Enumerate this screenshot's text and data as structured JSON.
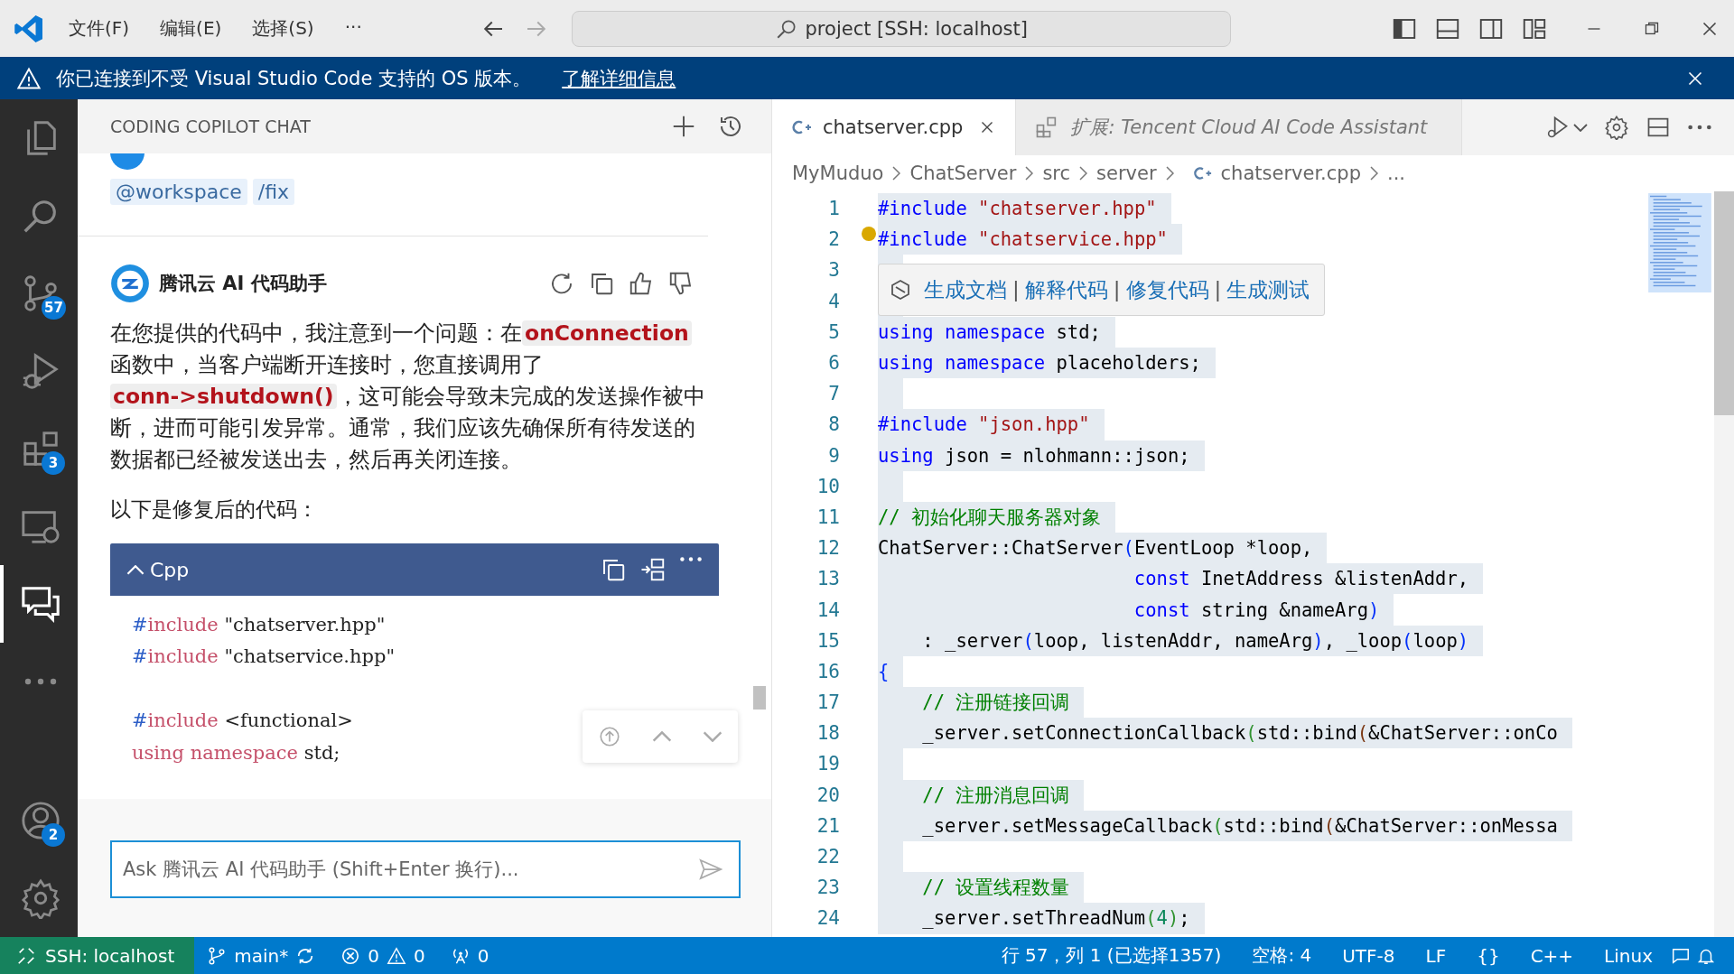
{
  "title_bar": {
    "menus": [
      "文件(F)",
      "编辑(E)",
      "选择(S)"
    ],
    "more": "···",
    "search": "project [SSH: localhost]"
  },
  "notification": {
    "message": "你已连接到不受 Visual Studio Code 支持的 OS 版本。",
    "link": "了解详细信息"
  },
  "activity_bar": {
    "items": [
      {
        "kind": "files",
        "selected": false
      },
      {
        "kind": "search",
        "selected": false
      },
      {
        "kind": "source-control",
        "selected": false,
        "badge": "57"
      },
      {
        "kind": "run-debug",
        "selected": false
      },
      {
        "kind": "extensions",
        "selected": false,
        "badge": "3"
      },
      {
        "kind": "remote",
        "selected": false
      },
      {
        "kind": "chat",
        "selected": true
      },
      {
        "kind": "more",
        "selected": false
      }
    ],
    "bottom": [
      {
        "kind": "account",
        "selected": false,
        "badge": "2"
      },
      {
        "kind": "settings",
        "selected": false
      }
    ]
  },
  "chat": {
    "title": "CODING COPILOT CHAT",
    "chips": [
      "@workspace",
      "/fix"
    ],
    "assistant": "腾讯云 AI 代码助手",
    "message": "在您提供的代码中，我注意到一个问题：在**onConnection**函数中，当客户端断开连接时，您直接调用了**conn->shutdown()**，这可能会导致未完成的发送操作被中断，进而可能引发异常。通常，我们应该先确保所有待发送的数据都已经被发送出去，然后再关闭连接。",
    "intro": "以下是修复后的代码：",
    "code_block": {
      "language": "Cpp",
      "expanded": true,
      "lines": [
        {
          "tokens": [
            {
              "kind": "hash",
              "t": "#"
            },
            {
              "kind": "kw",
              "t": "include"
            },
            {
              "kind": "plain",
              "t": " \"chatserver.hpp\""
            }
          ]
        },
        {
          "tokens": [
            {
              "kind": "hash",
              "t": "#"
            },
            {
              "kind": "kw",
              "t": "include"
            },
            {
              "kind": "plain",
              "t": " \"chatservice.hpp\""
            }
          ]
        },
        {
          "blank_before": true,
          "tokens": [
            {
              "kind": "hash",
              "t": "#"
            },
            {
              "kind": "kw",
              "t": "include"
            },
            {
              "kind": "plain",
              "t": " <functional>"
            }
          ]
        },
        {
          "tokens": [
            {
              "kind": "kw",
              "t": "using namespace"
            },
            {
              "kind": "plain",
              "t": " std;"
            }
          ]
        }
      ]
    },
    "input": {
      "placeholder": "Ask 腾讯云 AI 代码助手 (Shift+Enter 换行)..."
    }
  },
  "editor": {
    "tabs": [
      {
        "kind": "file",
        "label": "chatserver.cpp",
        "selected": true
      },
      {
        "kind": "extension",
        "label": "扩展: Tencent Cloud AI Code Assistant",
        "selected": false
      }
    ],
    "breadcrumb": [
      "MyMuduo",
      "ChatServer",
      "src",
      "server",
      "chatserver.cpp",
      "..."
    ],
    "codelens": {
      "items": [
        "生成文档",
        "解释代码",
        "修复代码",
        "生成测试"
      ],
      "separator": "|"
    },
    "lines": [
      {
        "number": "1",
        "selected": true,
        "tokens": [
          {
            "kind": "kw",
            "t": "#include "
          },
          {
            "kind": "str",
            "t": "\"chatserver.hpp\""
          }
        ]
      },
      {
        "number": "2",
        "selected": true,
        "tokens": [
          {
            "kind": "kw",
            "t": "#include "
          },
          {
            "kind": "str",
            "t": "\"chatservice.hpp\""
          }
        ]
      },
      {
        "number": "3",
        "selected": true
      },
      {
        "number": "4",
        "selected": true
      },
      {
        "number": "5",
        "selected": true,
        "tokens": [
          {
            "kind": "kw",
            "t": "using namespace"
          },
          {
            "kind": "plain",
            "t": " std;"
          }
        ]
      },
      {
        "number": "6",
        "selected": true,
        "tokens": [
          {
            "kind": "kw",
            "t": "using namespace"
          },
          {
            "kind": "plain",
            "t": " placeholders;"
          }
        ]
      },
      {
        "number": "7",
        "selected": true
      },
      {
        "number": "8",
        "selected": true,
        "tokens": [
          {
            "kind": "kw",
            "t": "#include "
          },
          {
            "kind": "str",
            "t": "\"json.hpp\""
          }
        ]
      },
      {
        "number": "9",
        "selected": true,
        "tokens": [
          {
            "kind": "kw",
            "t": "using"
          },
          {
            "kind": "plain",
            "t": " json = nlohmann::json;"
          }
        ]
      },
      {
        "number": "10",
        "selected": true
      },
      {
        "number": "11",
        "selected": true,
        "tokens": [
          {
            "kind": "cmt",
            "t": "// 初始化聊天服务器对象"
          }
        ]
      },
      {
        "number": "12",
        "selected": true,
        "tokens": [
          {
            "kind": "plain",
            "t": "ChatServer::ChatServer"
          },
          {
            "kind": "p1",
            "t": "("
          },
          {
            "kind": "plain",
            "t": "EventLoop *loop,"
          }
        ]
      },
      {
        "number": "13",
        "selected": true,
        "tokens": [
          {
            "kind": "kw",
            "t": "                       const"
          },
          {
            "kind": "plain",
            "t": " InetAddress &listenAddr,"
          }
        ]
      },
      {
        "number": "14",
        "selected": true,
        "tokens": [
          {
            "kind": "kw",
            "t": "                       const"
          },
          {
            "kind": "plain",
            "t": " string &nameArg"
          },
          {
            "kind": "p1",
            "t": ")"
          }
        ]
      },
      {
        "number": "15",
        "selected": true,
        "tokens": [
          {
            "kind": "plain",
            "t": "    : _server"
          },
          {
            "kind": "p1",
            "t": "("
          },
          {
            "kind": "plain",
            "t": "loop, listenAddr, nameArg"
          },
          {
            "kind": "p1",
            "t": ")"
          },
          {
            "kind": "plain",
            "t": ", _loop"
          },
          {
            "kind": "p1",
            "t": "("
          },
          {
            "kind": "plain",
            "t": "loop"
          },
          {
            "kind": "p1",
            "t": ")"
          }
        ]
      },
      {
        "number": "16",
        "selected": true,
        "tokens": [
          {
            "kind": "p1",
            "t": "{"
          }
        ]
      },
      {
        "number": "17",
        "selected": true,
        "tokens": [
          {
            "kind": "cmt",
            "t": "    // 注册链接回调"
          }
        ]
      },
      {
        "number": "18",
        "selected": true,
        "tokens": [
          {
            "kind": "plain",
            "t": "    _server.setConnectionCallback"
          },
          {
            "kind": "p2",
            "t": "("
          },
          {
            "kind": "plain",
            "t": "std::bind"
          },
          {
            "kind": "p3",
            "t": "("
          },
          {
            "kind": "plain",
            "t": "&ChatServer::onCo"
          }
        ]
      },
      {
        "number": "19",
        "selected": true
      },
      {
        "number": "20",
        "selected": true,
        "tokens": [
          {
            "kind": "cmt",
            "t": "    // 注册消息回调"
          }
        ]
      },
      {
        "number": "21",
        "selected": true,
        "tokens": [
          {
            "kind": "plain",
            "t": "    _server.setMessageCallback"
          },
          {
            "kind": "p2",
            "t": "("
          },
          {
            "kind": "plain",
            "t": "std::bind"
          },
          {
            "kind": "p3",
            "t": "("
          },
          {
            "kind": "plain",
            "t": "&ChatServer::onMessa"
          }
        ]
      },
      {
        "number": "22",
        "selected": true
      },
      {
        "number": "23",
        "selected": true,
        "tokens": [
          {
            "kind": "cmt",
            "t": "    // 设置线程数量"
          }
        ]
      },
      {
        "number": "24",
        "selected": true,
        "tokens": [
          {
            "kind": "plain",
            "t": "    _server.setThreadNum"
          },
          {
            "kind": "p2",
            "t": "("
          },
          {
            "kind": "num",
            "t": "4"
          },
          {
            "kind": "p2",
            "t": ")"
          },
          {
            "kind": "plain",
            "t": ";"
          }
        ]
      }
    ]
  },
  "status_bar": {
    "remote": "SSH: localhost",
    "branch": "main*",
    "errors": "0",
    "warnings": "0",
    "ports": "0",
    "right": [
      "行 57，列 1 (已选择1357)",
      "空格: 4",
      "UTF-8",
      "LF",
      "{}",
      "C++",
      "Linux"
    ]
  }
}
